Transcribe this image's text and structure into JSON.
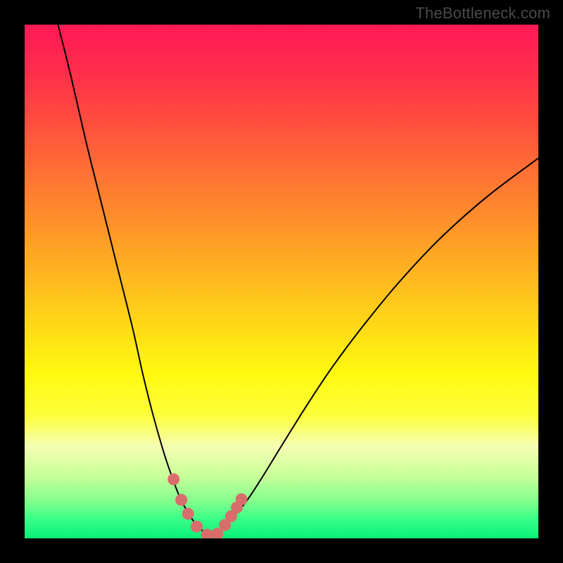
{
  "watermark": "TheBottleneck.com",
  "colors": {
    "curve_stroke": "#000000",
    "marker_fill": "#d86e6c",
    "marker_stroke": "#d86e6c",
    "frame_bg": "#000000"
  },
  "chart_data": {
    "type": "line",
    "title": "",
    "xlabel": "",
    "ylabel": "",
    "xlim": [
      0,
      100
    ],
    "ylim": [
      0,
      100
    ],
    "series": [
      {
        "name": "left-curve",
        "x": [
          6.5,
          9,
          12,
          15,
          18,
          21,
          23,
          25,
          27,
          28.5,
          30,
          31.5,
          33,
          34.5,
          36
        ],
        "y": [
          100,
          90,
          77,
          65,
          53,
          41,
          32,
          24,
          17,
          12.5,
          8.5,
          5.5,
          3.2,
          1.6,
          0.5
        ]
      },
      {
        "name": "right-curve",
        "x": [
          36,
          38,
          40,
          43,
          46,
          50,
          55,
          60,
          66,
          73,
          81,
          90,
          100
        ],
        "y": [
          0.5,
          1.5,
          3.5,
          7,
          11.5,
          18,
          26,
          33.5,
          41.5,
          50,
          58.5,
          66.5,
          74
        ]
      }
    ],
    "markers": {
      "name": "highlighted-points",
      "x": [
        29.0,
        30.5,
        31.8,
        33.5,
        35.5,
        37.5,
        39.0,
        40.2,
        41.3,
        42.2
      ],
      "y": [
        11.5,
        7.5,
        4.8,
        2.3,
        0.7,
        0.9,
        2.6,
        4.3,
        6.0,
        7.6
      ]
    }
  }
}
